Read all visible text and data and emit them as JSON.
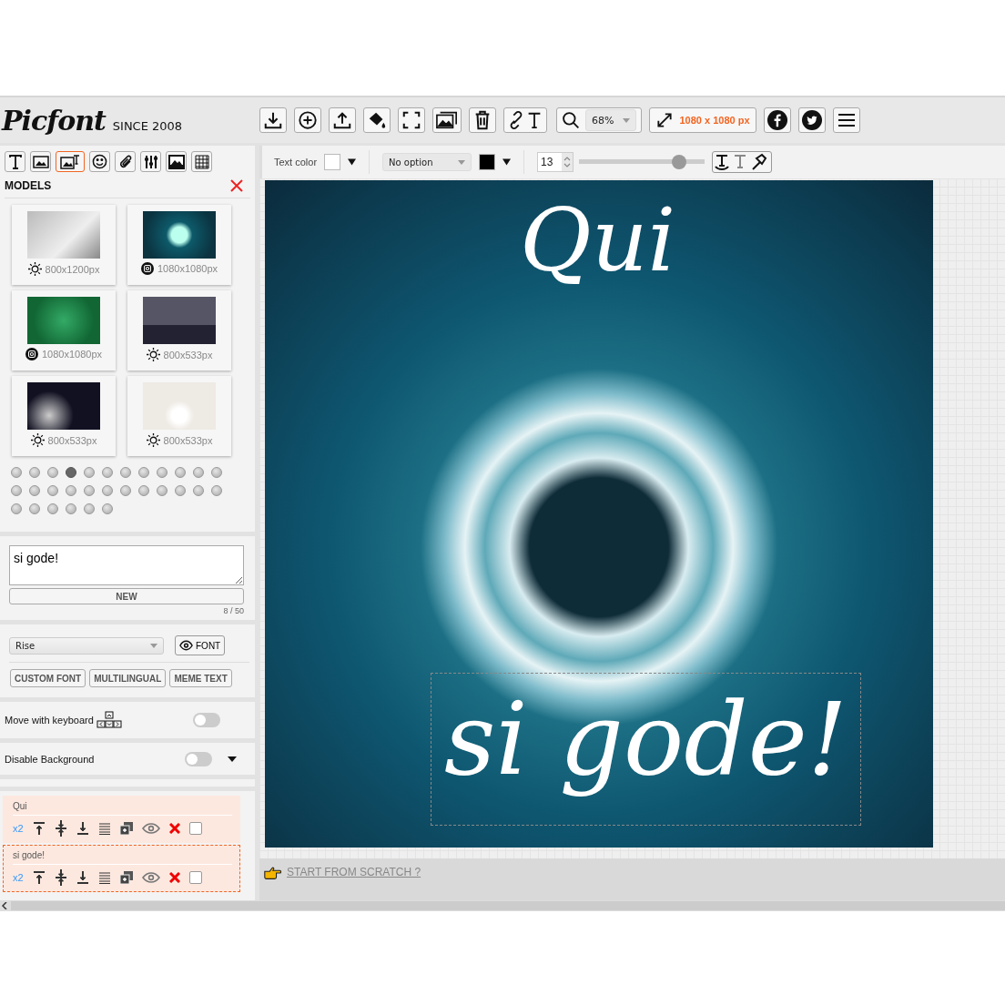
{
  "header": {
    "logo": "Picfont",
    "tagline": "SINCE 2008",
    "zoom": "68%",
    "size": "1080 x 1080 px"
  },
  "tools": [
    {
      "kind": "text",
      "selected": false
    },
    {
      "kind": "image",
      "selected": false
    },
    {
      "kind": "image-text",
      "selected": true
    },
    {
      "kind": "emoji",
      "selected": false
    },
    {
      "kind": "clip",
      "selected": false
    },
    {
      "kind": "sliders",
      "selected": false
    },
    {
      "kind": "frame",
      "selected": false
    },
    {
      "kind": "grid",
      "selected": false
    }
  ],
  "models": {
    "title": "MODELS",
    "items": [
      {
        "size": "800x1200px",
        "kind": "sun"
      },
      {
        "size": "1080x1080px",
        "kind": "instagram"
      },
      {
        "size": "1080x1080px",
        "kind": "instagram"
      },
      {
        "size": "800x533px",
        "kind": "sun"
      },
      {
        "size": "800x533px",
        "kind": "sun"
      },
      {
        "size": "800x533px",
        "kind": "sun"
      }
    ],
    "pages": [
      {
        "selected": false
      },
      {
        "selected": false
      },
      {
        "selected": false
      },
      {
        "selected": true
      },
      {
        "selected": false
      },
      {
        "selected": false
      },
      {
        "selected": false
      },
      {
        "selected": false
      },
      {
        "selected": false
      },
      {
        "selected": false
      },
      {
        "selected": false
      },
      {
        "selected": false
      },
      {
        "selected": false
      },
      {
        "selected": false
      },
      {
        "selected": false
      },
      {
        "selected": false
      },
      {
        "selected": false
      },
      {
        "selected": false
      },
      {
        "selected": false
      },
      {
        "selected": false
      },
      {
        "selected": false
      },
      {
        "selected": false
      },
      {
        "selected": false
      },
      {
        "selected": false
      },
      {
        "selected": false
      },
      {
        "selected": false
      },
      {
        "selected": false
      },
      {
        "selected": false
      },
      {
        "selected": false
      },
      {
        "selected": false
      }
    ]
  },
  "text_input": {
    "value": "si gode!",
    "button": "NEW",
    "counter": "8 / 50"
  },
  "font": {
    "value": "Rise",
    "button": "FONT",
    "options": [
      "CUSTOM FONT",
      "MULTILINGUAL",
      "MEME TEXT"
    ]
  },
  "toggles": [
    {
      "label": "Move with keyboard",
      "kind": "keyboard",
      "on": false
    },
    {
      "label": "Disable Background",
      "kind": "caret",
      "on": false
    }
  ],
  "layers": [
    {
      "label": "Qui",
      "scale": "x2",
      "selected": false,
      "checked": false
    },
    {
      "label": "si gode!",
      "scale": "x2",
      "selected": true,
      "checked": false
    }
  ],
  "text_options": {
    "color_label": "Text color",
    "effect": "No option",
    "font_size": "13",
    "slider": {
      "level": 0.8
    }
  },
  "canvas": {
    "texts": [
      {
        "text": "Qui",
        "selected": false
      },
      {
        "text": "si gode!",
        "selected": true
      }
    ]
  },
  "footer": {
    "link": "START FROM SCRATCH ?"
  }
}
